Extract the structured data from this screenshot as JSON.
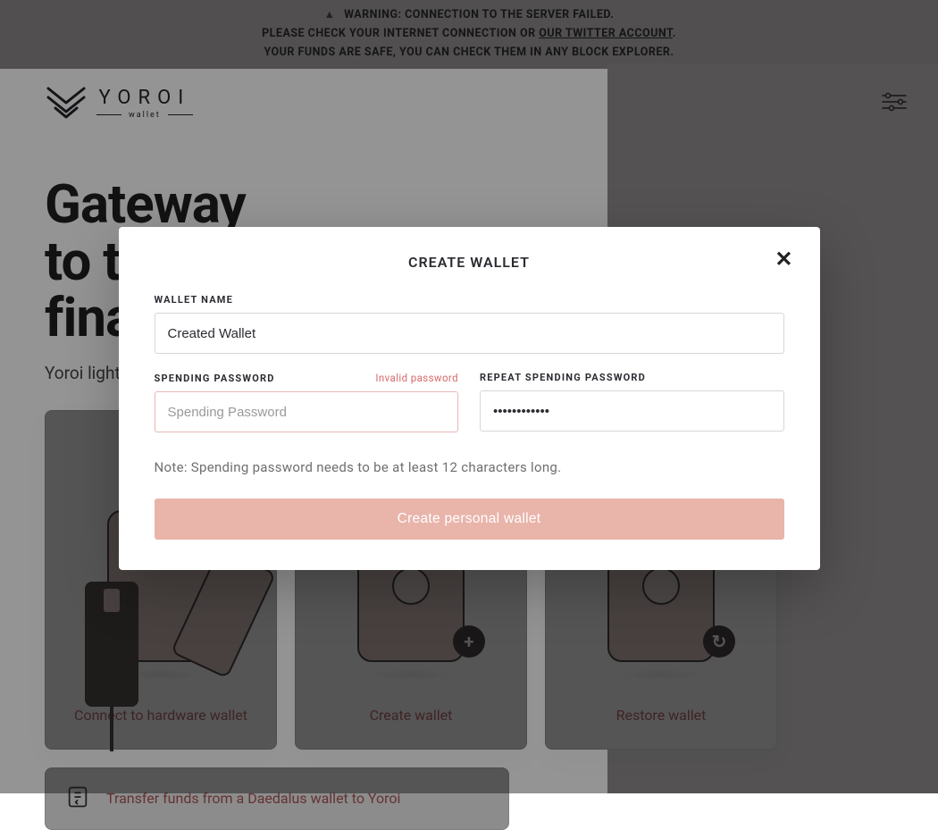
{
  "banner": {
    "line1_prefix": "WARNING: CONNECTION TO THE SERVER FAILED.",
    "line2_prefix": "PLEASE CHECK YOUR INTERNET CONNECTION OR ",
    "twitter_link": "OUR TWITTER ACCOUNT",
    "line2_suffix": ".",
    "line3": "YOUR FUNDS ARE SAFE, YOU CAN CHECK THEM IN ANY BLOCK EXPLORER."
  },
  "header": {
    "brand": "YOROI",
    "brand_sub": "wallet"
  },
  "hero": {
    "title_line1": "Gateway",
    "title_line2": "to the",
    "title_line3": "financial world",
    "tagline": "Yoroi light wallet for Cardano assets"
  },
  "cards": [
    {
      "label": "Connect to hardware wallet"
    },
    {
      "label": "Create wallet",
      "badge": "+"
    },
    {
      "label": "Restore wallet",
      "badge": "↻"
    }
  ],
  "transfer": {
    "label": "Transfer funds from a Daedalus wallet to Yoroi"
  },
  "modal": {
    "title": "CREATE WALLET",
    "wallet_name_label": "WALLET NAME",
    "wallet_name_value": "Created Wallet",
    "spending_label": "SPENDING PASSWORD",
    "spending_placeholder": "Spending Password",
    "spending_error": "Invalid password",
    "repeat_label": "REPEAT SPENDING PASSWORD",
    "repeat_value": "••••••••••••",
    "note": "Note: Spending password needs to be at least 12 characters long.",
    "submit": "Create personal wallet"
  },
  "colors": {
    "accent": "#e9b4aa",
    "error": "#d56b6b"
  }
}
